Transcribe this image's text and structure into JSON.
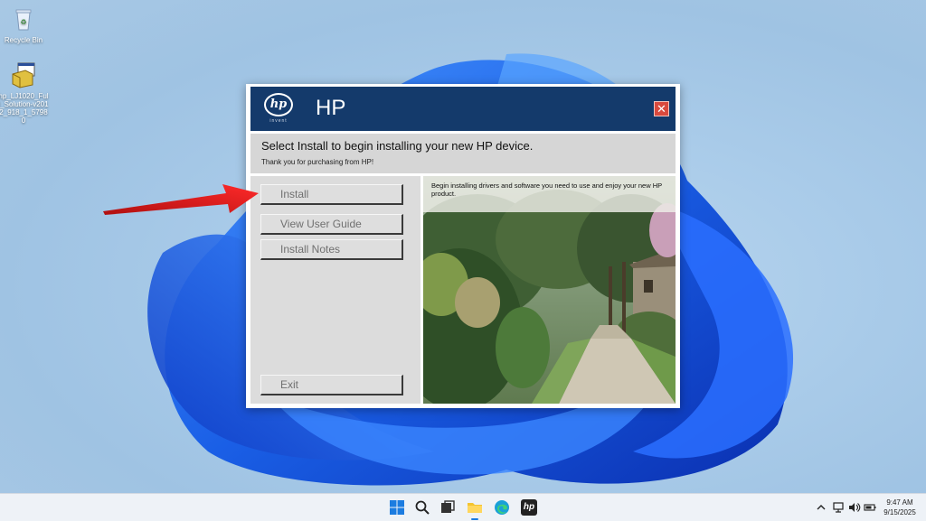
{
  "desktop": {
    "icons": [
      {
        "label": "Recycle Bin",
        "icon": "recycle-bin-icon"
      },
      {
        "label": "hp_LJ1020_Full_Solution-v2012_918_1_57980",
        "icon": "installer-package-icon"
      }
    ]
  },
  "installer": {
    "brand_title": "HP",
    "logo_text": "hp",
    "logo_tagline": "invent",
    "header_title": "Select Install to begin installing your new HP device.",
    "header_subtitle": "Thank you for purchasing from HP!",
    "buttons": {
      "install": "Install",
      "view_user_guide": "View User Guide",
      "install_notes": "Install Notes",
      "exit": "Exit"
    },
    "description": "Begin installing drivers and software you need to use and enjoy your new HP product."
  },
  "taskbar": {
    "icons": [
      "windows-start-icon",
      "search-icon",
      "task-view-icon",
      "file-explorer-icon",
      "edge-browser-icon",
      "hp-installer-icon"
    ],
    "tray": [
      "chevron-up-icon",
      "network-icon",
      "volume-icon",
      "battery-icon"
    ],
    "time": "9:47 AM",
    "date": "9/15/2025"
  },
  "colors": {
    "banner": "#143a6b",
    "arrow": "#e81d1d",
    "close": "#d94a3e"
  }
}
